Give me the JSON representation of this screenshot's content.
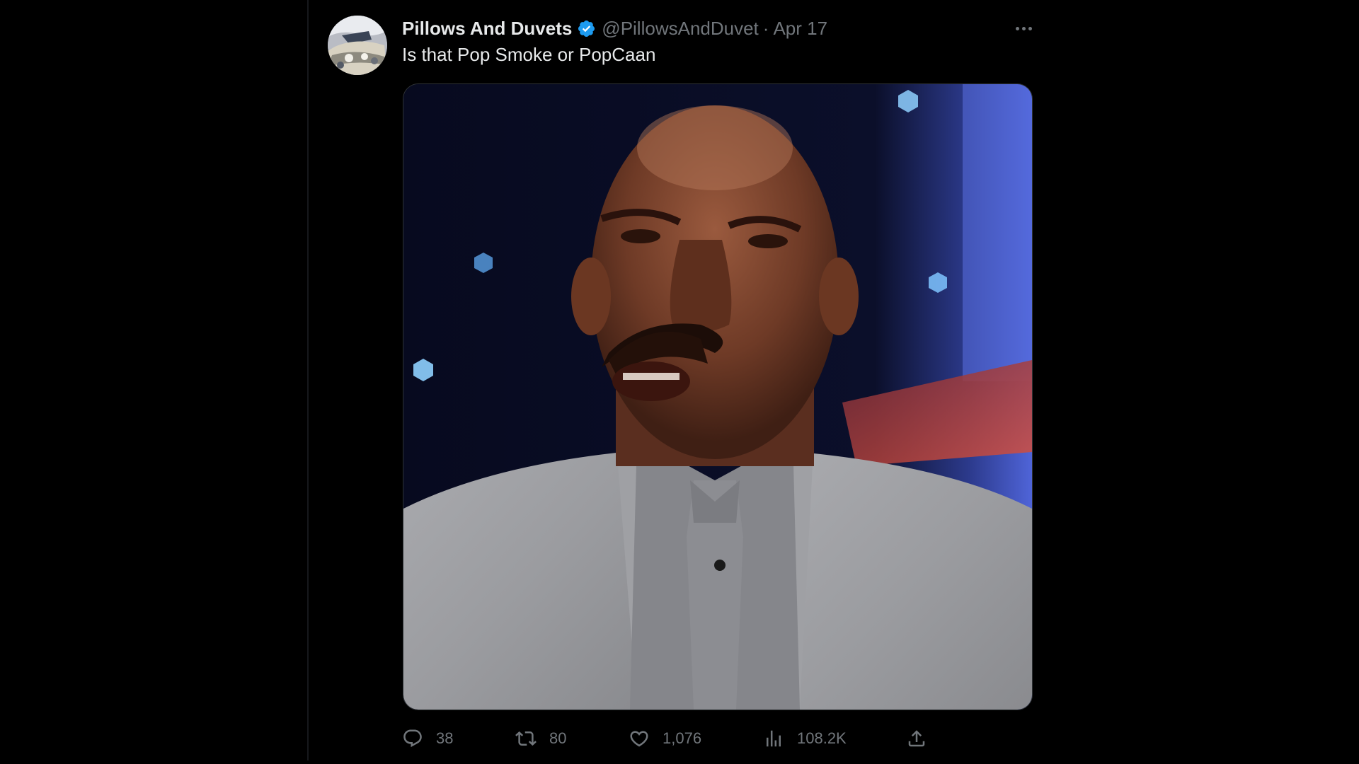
{
  "tweet": {
    "display_name": "Pillows And Duvets",
    "verified_icon": "verified-badge-icon",
    "handle": "@PillowsAndDuvet",
    "separator": "·",
    "date": "Apr 17",
    "text": "Is that Pop Smoke or PopCaan",
    "more_icon": "more-options-icon",
    "media": {
      "type": "photo",
      "image_icon": "photo-media"
    },
    "actions": {
      "reply": {
        "icon": "reply-icon",
        "count": "38"
      },
      "retweet": {
        "icon": "retweet-icon",
        "count": "80"
      },
      "like": {
        "icon": "heart-icon",
        "count": "1,076"
      },
      "views": {
        "icon": "views-icon",
        "count": "108.2K"
      },
      "share": {
        "icon": "share-icon"
      }
    }
  },
  "colors": {
    "background": "#000000",
    "primary_text": "#e7e9ea",
    "secondary_text": "#71767b",
    "verified": "#1d9bf0",
    "border": "#2f3336"
  }
}
